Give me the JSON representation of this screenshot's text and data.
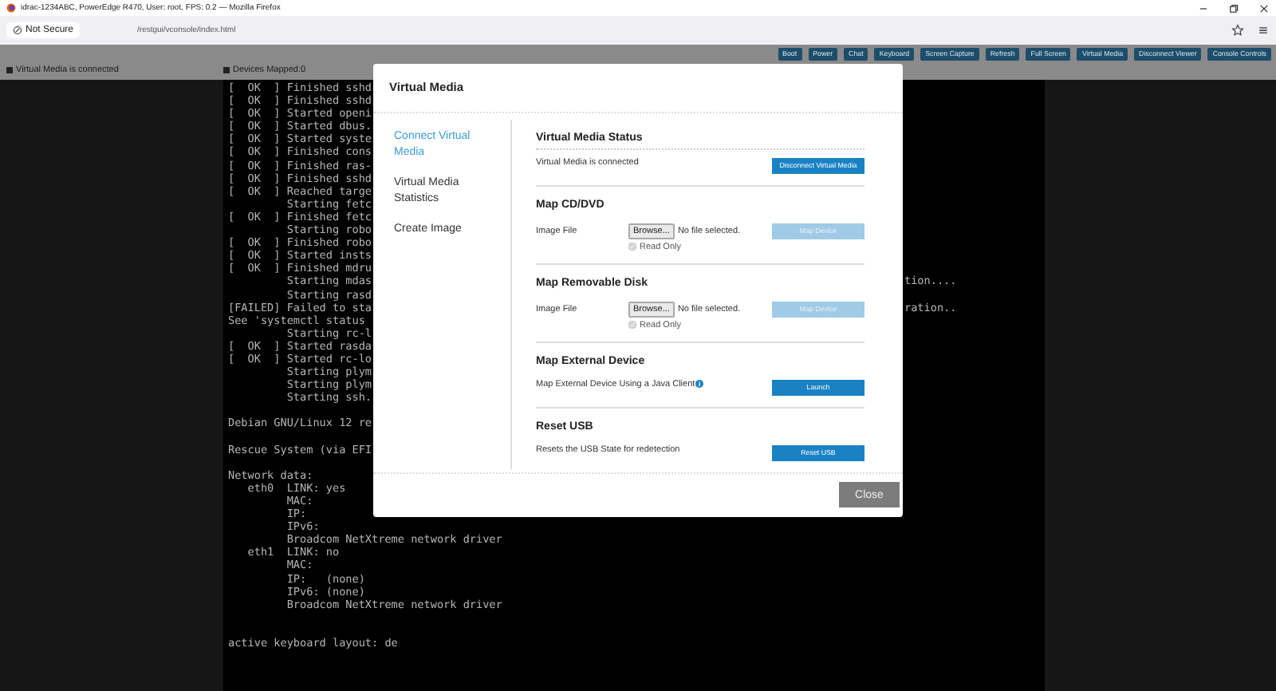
{
  "window": {
    "title": "idrac-1234ABC, PowerEdge R470, User: root, FPS: 0.2 — Mozilla Firefox"
  },
  "browser": {
    "security": "Not Secure",
    "url": "/restgui/vconsole/index.html"
  },
  "toolbar": {
    "buttons": [
      "Boot",
      "Power",
      "Chat",
      "Keyboard",
      "Screen Capture",
      "Refresh",
      "Full Screen",
      "Virtual Media",
      "Disconnect Viewer",
      "Console Controls"
    ]
  },
  "status": {
    "media": "Virtual Media is connected",
    "devices": "Devices Mapped:0"
  },
  "console": {
    "lines": [
      {
        "kind": "text",
        "text": "[  OK  ] Finished sshd"
      },
      {
        "kind": "text",
        "text": "[  OK  ] Finished sshd"
      },
      {
        "kind": "text",
        "text": "[  OK  ] Started openi"
      },
      {
        "kind": "text",
        "text": "[  OK  ] Started dbus."
      },
      {
        "kind": "text",
        "text": "[  OK  ] Started syste"
      },
      {
        "kind": "text",
        "text": "[  OK  ] Finished cons"
      },
      {
        "kind": "text",
        "text": "[  OK  ] Finished ras-"
      },
      {
        "kind": "text",
        "text": "[  OK  ] Finished sshd"
      },
      {
        "kind": "text",
        "text": "[  OK  ] Reached targe"
      },
      {
        "kind": "text",
        "text": "         Starting fetc"
      },
      {
        "kind": "text",
        "text": "[  OK  ] Finished fetc"
      },
      {
        "kind": "text",
        "text": "         Starting robo"
      },
      {
        "kind": "text",
        "text": "[  OK  ] Finished robo"
      },
      {
        "kind": "text",
        "text": "[  OK  ] Started insts"
      },
      {
        "kind": "text",
        "text": "[  OK  ] Finished mdru"
      },
      {
        "kind": "text",
        "text": "         Starting mdas",
        "tail": "tion...."
      },
      {
        "kind": "text",
        "text": "         Starting rasd"
      },
      {
        "kind": "text",
        "text": "[FAILED] Failed to sta",
        "tail": "ration.."
      },
      {
        "kind": "text",
        "text": "See 'systemctl status"
      },
      {
        "kind": "text",
        "text": "         Starting rc-l"
      },
      {
        "kind": "text",
        "text": "[  OK  ] Started rasda"
      },
      {
        "kind": "text",
        "text": "[  OK  ] Started rc-lo"
      },
      {
        "kind": "text",
        "text": "         Starting plym"
      },
      {
        "kind": "text",
        "text": "         Starting plym"
      },
      {
        "kind": "text",
        "text": "         Starting ssh."
      },
      {
        "kind": "blank"
      },
      {
        "kind": "text",
        "text": "Debian GNU/Linux 12 re"
      },
      {
        "kind": "blank"
      },
      {
        "kind": "text",
        "text": "Rescue System (via EFI"
      },
      {
        "kind": "blank"
      },
      {
        "kind": "text",
        "text": "Network data:"
      },
      {
        "kind": "text",
        "text": "   eth0  LINK: yes"
      },
      {
        "kind": "text",
        "text": "         MAC:"
      },
      {
        "kind": "text",
        "text": "         IP:"
      },
      {
        "kind": "text",
        "text": "         IPv6:"
      },
      {
        "kind": "text",
        "text": "         Broadcom NetXtreme network driver"
      },
      {
        "kind": "text",
        "text": "   eth1  LINK: no"
      },
      {
        "kind": "text",
        "text": "         MAC:"
      },
      {
        "kind": "text",
        "text": "         IP:   (none)"
      },
      {
        "kind": "text",
        "text": "         IPv6: (none)"
      },
      {
        "kind": "text",
        "text": "         Broadcom NetXtreme network driver"
      },
      {
        "kind": "blank"
      },
      {
        "kind": "blank"
      },
      {
        "kind": "text",
        "text": "active keyboard layout: de"
      }
    ]
  },
  "dialog": {
    "title": "Virtual Media",
    "nav": [
      {
        "label": "Connect Virtual Media",
        "selected": true
      },
      {
        "label": "Virtual Media Statistics",
        "selected": false
      },
      {
        "label": "Create Image",
        "selected": false
      }
    ],
    "sections": [
      {
        "heading": "Virtual Media Status",
        "label": "Virtual Media is connected",
        "info": false,
        "button": {
          "label": "Disconnect Virtual Media",
          "disabled": false
        }
      },
      {
        "heading": "Map CD/DVD",
        "label": "Image File",
        "info": false,
        "file": {
          "browse": "Browse...",
          "value": "No file selected."
        },
        "checkbox": {
          "label": "Read Only",
          "checked": true,
          "disabled": true
        },
        "button": {
          "label": "Map Device",
          "disabled": true
        }
      },
      {
        "heading": "Map Removable Disk",
        "label": "Image File",
        "info": false,
        "file": {
          "browse": "Browse...",
          "value": "No file selected."
        },
        "checkbox": {
          "label": "Read Only",
          "checked": true,
          "disabled": true
        },
        "button": {
          "label": "Map Device",
          "disabled": true
        }
      },
      {
        "heading": "Map External Device",
        "label": "Map External Device Using a Java Client",
        "info": true,
        "button": {
          "label": "Launch",
          "disabled": false
        }
      },
      {
        "heading": "Reset USB",
        "label": "Resets the USB State for redetection",
        "info": false,
        "button": {
          "label": "Reset USB",
          "disabled": false
        }
      }
    ],
    "close": "Close"
  }
}
